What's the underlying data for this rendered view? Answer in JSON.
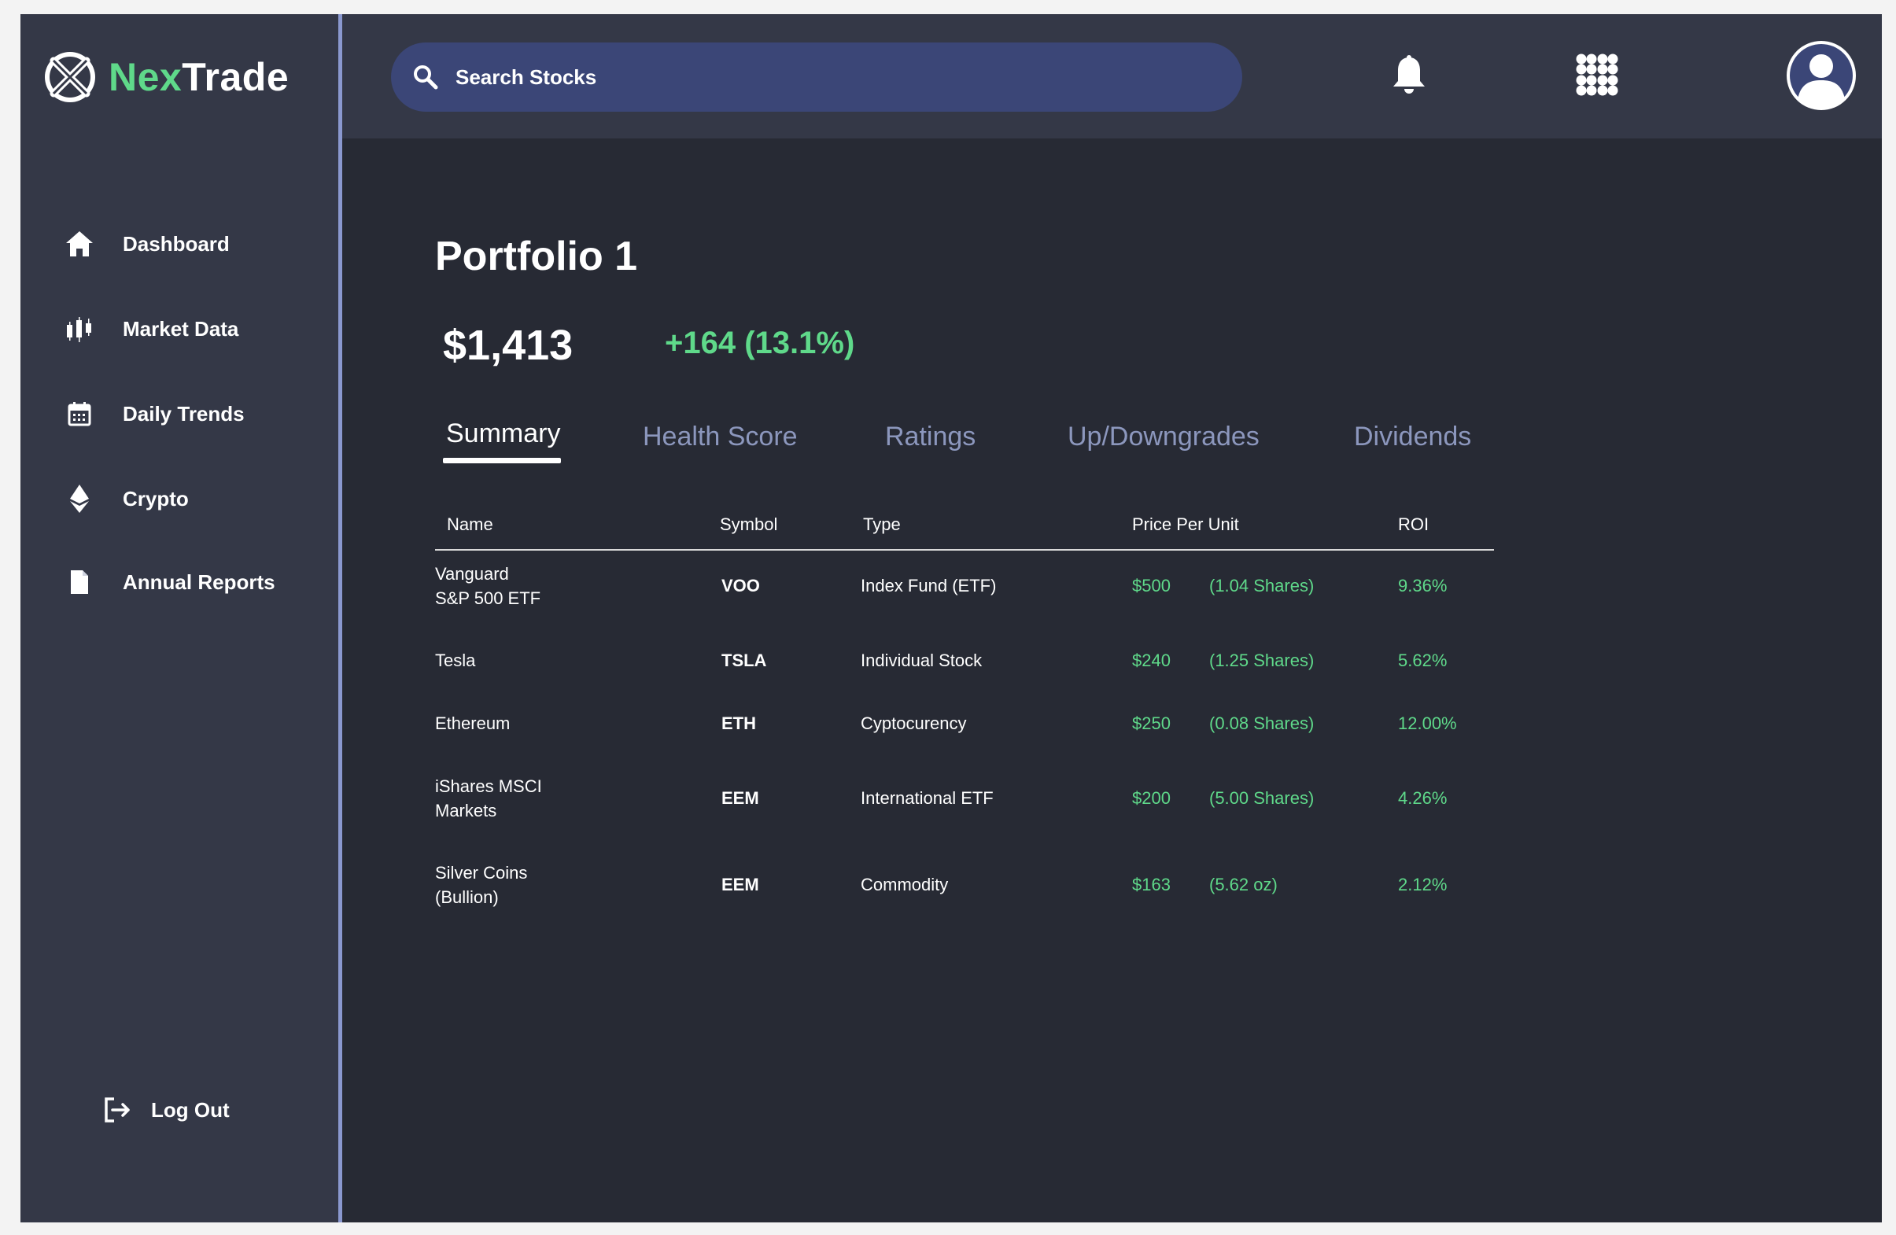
{
  "app": {
    "brand_part1": "Nex",
    "brand_part2": "Trade",
    "accent_color": "#5fd98a",
    "sidebar_color": "#343847",
    "search_color": "#3b4677"
  },
  "sidebar": {
    "items": [
      {
        "label": "Dashboard",
        "icon": "home-icon"
      },
      {
        "label": "Market Data",
        "icon": "candlestick-icon"
      },
      {
        "label": "Daily Trends",
        "icon": "calendar-icon"
      },
      {
        "label": "Crypto",
        "icon": "ethereum-icon"
      },
      {
        "label": "Annual Reports",
        "icon": "document-icon"
      }
    ],
    "logout_label": "Log Out"
  },
  "header": {
    "search_placeholder": "Search Stocks",
    "icons": [
      "search-icon",
      "bell-icon",
      "apps-grid-icon",
      "user-avatar-icon"
    ]
  },
  "portfolio": {
    "title": "Portfolio 1",
    "value": "$1,413",
    "change": "+164 (13.1%)"
  },
  "tabs": [
    {
      "label": "Summary",
      "active": true
    },
    {
      "label": "Health Score",
      "active": false
    },
    {
      "label": "Ratings",
      "active": false
    },
    {
      "label": "Up/Downgrades",
      "active": false
    },
    {
      "label": "Dividends",
      "active": false
    }
  ],
  "table": {
    "headers": [
      "Name",
      "Symbol",
      "Type",
      "Price Per Unit",
      "ROI"
    ],
    "rows": [
      {
        "name_1": "Vanguard",
        "name_2": "S&P 500 ETF",
        "symbol": "VOO",
        "type": "Index Fund (ETF)",
        "price": "$500",
        "units": "(1.04 Shares)",
        "roi": "9.36%"
      },
      {
        "name_1": "Tesla",
        "name_2": "",
        "symbol": "TSLA",
        "type": "Individual Stock",
        "price": "$240",
        "units": "(1.25 Shares)",
        "roi": "5.62%"
      },
      {
        "name_1": "Ethereum",
        "name_2": "",
        "symbol": "ETH",
        "type": "Cyptocurency",
        "price": "$250",
        "units": "(0.08 Shares)",
        "roi": "12.00%"
      },
      {
        "name_1": "iShares MSCI",
        "name_2": "Markets",
        "symbol": "EEM",
        "type": "International ETF",
        "price": "$200",
        "units": "(5.00 Shares)",
        "roi": "4.26%"
      },
      {
        "name_1": "Silver Coins",
        "name_2": "(Bullion)",
        "symbol": "EEM",
        "type": "Commodity",
        "price": "$163",
        "units": "(5.62 oz)",
        "roi": "2.12%"
      }
    ]
  }
}
